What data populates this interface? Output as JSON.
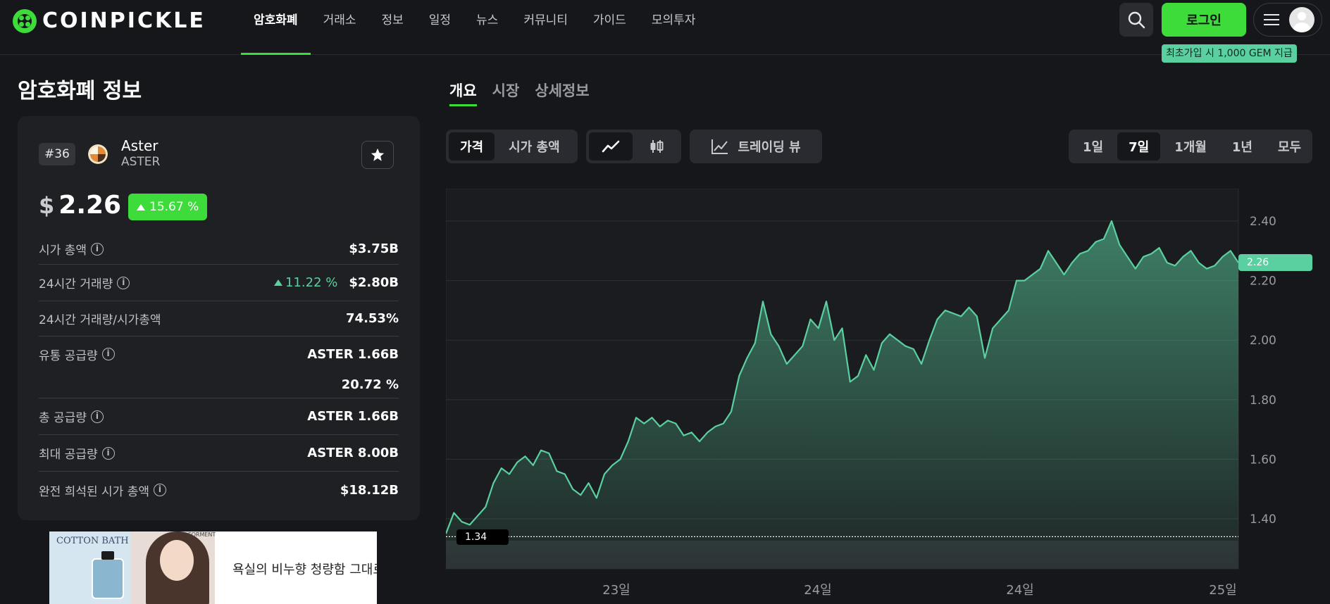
{
  "header": {
    "brand": "COINPICKLE",
    "nav": [
      "암호화폐",
      "거래소",
      "정보",
      "일정",
      "뉴스",
      "커뮤니티",
      "가이드",
      "모의투자"
    ],
    "login_label": "로그인",
    "promo_tip": "최초가입 시 1,000 GEM 지급"
  },
  "left": {
    "page_title": "암호화폐 정보",
    "coin": {
      "rank": "#36",
      "name": "Aster",
      "symbol": "ASTER",
      "currency_symbol": "$",
      "price": "2.26",
      "change": "15.67 %"
    },
    "stats": [
      {
        "label": "시가 총액",
        "value": "$3.75B",
        "pct": ""
      },
      {
        "label": "24시간 거래량",
        "value": "$2.80B",
        "pct": "11.22 %"
      },
      {
        "label": "24시간 거래량/시가총액",
        "value": "74.53%",
        "pct": ""
      },
      {
        "label": "유통 공급량",
        "value": "ASTER 1.66B",
        "pct": ""
      },
      {
        "label": "",
        "value": "20.72 %",
        "pct": ""
      },
      {
        "label": "총 공급량",
        "value": "ASTER 1.66B",
        "pct": ""
      },
      {
        "label": "최대 공급량",
        "value": "ASTER 8.00B",
        "pct": ""
      },
      {
        "label": "완전 희석된 시가 총액",
        "value": "$18.12B",
        "pct": ""
      }
    ],
    "ad": {
      "brand_left": "COTTON BATH",
      "brand_photo": "FORMENT",
      "text": "욕실의 비누향 청량함 그대로"
    }
  },
  "right": {
    "tabs": [
      "개요",
      "시장",
      "상세정보"
    ],
    "type_toggle": [
      "가격",
      "시가 총액"
    ],
    "tradingview_label": "트레이딩 뷰",
    "ranges": [
      "1일",
      "7일",
      "1개월",
      "1년",
      "모두"
    ],
    "active_range": "7일"
  },
  "colors": {
    "accent": "#3ddc3a",
    "line": "#5ad0a0",
    "background": "#16171a",
    "panel": "#1f2024"
  },
  "chart_data": {
    "type": "area",
    "y_ticks": [
      2.4,
      2.2,
      2.0,
      1.8,
      1.6,
      1.4
    ],
    "ylim": [
      1.28,
      2.5
    ],
    "x_ticks": [
      "23일",
      "24일",
      "24일",
      "25일"
    ],
    "current_price_label": "2.26",
    "min_price_label": "1.34",
    "min_price": 1.34,
    "current_price": 2.26,
    "x": [
      0,
      1,
      2,
      3,
      4,
      5,
      6,
      7,
      8,
      9,
      10,
      11,
      12,
      13,
      14,
      15,
      16,
      17,
      18,
      19,
      20,
      21,
      22,
      23,
      24,
      25,
      26,
      27,
      28,
      29,
      30,
      31,
      32,
      33,
      34,
      35,
      36,
      37,
      38,
      39,
      40,
      41,
      42,
      43,
      44,
      45,
      46,
      47,
      48,
      49,
      50,
      51,
      52,
      53,
      54,
      55,
      56,
      57,
      58,
      59,
      60,
      61,
      62,
      63,
      64,
      65,
      66,
      67,
      68,
      69,
      70,
      71,
      72,
      73,
      74,
      75,
      76,
      77,
      78,
      79,
      80,
      81,
      82,
      83,
      84,
      85,
      86,
      87,
      88,
      89,
      90,
      91,
      92,
      93,
      94,
      95,
      96,
      97,
      98,
      99,
      100
    ],
    "values": [
      1.35,
      1.42,
      1.39,
      1.38,
      1.41,
      1.44,
      1.52,
      1.57,
      1.55,
      1.59,
      1.61,
      1.58,
      1.63,
      1.62,
      1.56,
      1.55,
      1.5,
      1.48,
      1.52,
      1.47,
      1.55,
      1.58,
      1.6,
      1.66,
      1.74,
      1.72,
      1.74,
      1.71,
      1.73,
      1.72,
      1.68,
      1.69,
      1.66,
      1.69,
      1.71,
      1.72,
      1.76,
      1.88,
      1.94,
      1.99,
      2.13,
      2.02,
      1.98,
      1.92,
      1.95,
      1.98,
      2.07,
      2.04,
      2.13,
      2.0,
      2.04,
      1.86,
      1.88,
      1.95,
      1.9,
      1.99,
      2.02,
      2.0,
      1.98,
      1.97,
      1.92,
      2.0,
      2.07,
      2.1,
      2.09,
      2.08,
      2.11,
      2.08,
      1.94,
      2.04,
      2.07,
      2.1,
      2.2,
      2.2,
      2.22,
      2.24,
      2.3,
      2.26,
      2.22,
      2.26,
      2.29,
      2.3,
      2.33,
      2.34,
      2.4,
      2.32,
      2.28,
      2.24,
      2.28,
      2.29,
      2.31,
      2.26,
      2.25,
      2.28,
      2.3,
      2.26,
      2.24,
      2.25,
      2.28,
      2.3,
      2.26
    ],
    "grid": true
  }
}
